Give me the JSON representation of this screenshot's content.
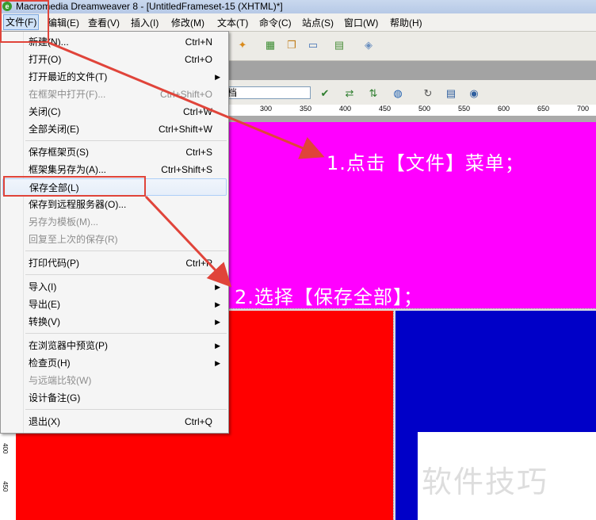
{
  "window": {
    "title": "Macromedia Dreamweaver 8 - [UntitledFrameset-15 (XHTML)*]"
  },
  "menubar": [
    "文件(F)",
    "编辑(E)",
    "查看(V)",
    "插入(I)",
    "修改(M)",
    "文本(T)",
    "命令(C)",
    "站点(S)",
    "窗口(W)",
    "帮助(H)"
  ],
  "title_field": {
    "value": "档"
  },
  "ruler": [
    "300",
    "350",
    "400",
    "450",
    "500",
    "550",
    "600",
    "650",
    "700"
  ],
  "vruler": [
    "400",
    "450"
  ],
  "file_menu": [
    {
      "label": "新建(N)...",
      "shortcut": "Ctrl+N"
    },
    {
      "label": "打开(O)",
      "shortcut": "Ctrl+O"
    },
    {
      "label": "打开最近的文件(T)",
      "shortcut": "",
      "submenu": true
    },
    {
      "label": "在框架中打开(F)...",
      "shortcut": "Ctrl+Shift+O",
      "disabled": true
    },
    {
      "label": "关闭(C)",
      "shortcut": "Ctrl+W"
    },
    {
      "label": "全部关闭(E)",
      "shortcut": "Ctrl+Shift+W"
    },
    {
      "label": "保存框架页(S)",
      "shortcut": "Ctrl+S"
    },
    {
      "label": "框架集另存为(A)...",
      "shortcut": "Ctrl+Shift+S"
    },
    {
      "label": "保存全部(L)",
      "shortcut": "",
      "highlighted": true
    },
    {
      "label": "保存到远程服务器(O)...",
      "shortcut": ""
    },
    {
      "label": "另存为模板(M)...",
      "shortcut": "",
      "disabled": true
    },
    {
      "label": "回复至上次的保存(R)",
      "shortcut": "",
      "disabled": true
    },
    {
      "label": "打印代码(P)",
      "shortcut": "Ctrl+P"
    },
    {
      "label": "导入(I)",
      "shortcut": "",
      "submenu": true
    },
    {
      "label": "导出(E)",
      "shortcut": "",
      "submenu": true
    },
    {
      "label": "转换(V)",
      "shortcut": "",
      "submenu": true
    },
    {
      "label": "在浏览器中预览(P)",
      "shortcut": "",
      "submenu": true
    },
    {
      "label": "检查页(H)",
      "shortcut": "",
      "submenu": true
    },
    {
      "label": "与远端比较(W)",
      "shortcut": "",
      "disabled": true
    },
    {
      "label": "设计备注(G)",
      "shortcut": ""
    },
    {
      "label": "退出(X)",
      "shortcut": "Ctrl+Q"
    }
  ],
  "annotations": {
    "step1": "1.点击【文件】菜单；",
    "step2": "2.选择【保存全部】；"
  },
  "watermark": "软件技巧",
  "colors": {
    "annotation_red": "#e0443a",
    "frame_top": "#ff00ff",
    "frame_left": "#ff0000",
    "frame_right": "#0000c8"
  }
}
